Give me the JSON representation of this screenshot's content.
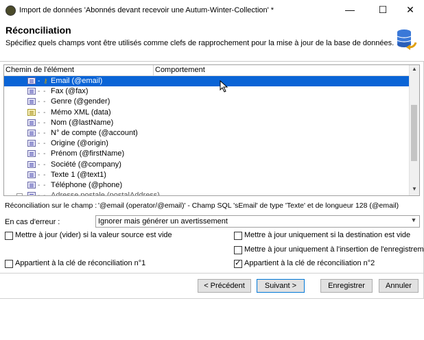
{
  "window": {
    "title": "Import de données 'Abonnés devant recevoir une Autum-Winter-Collection' *",
    "minimize": "—",
    "maximize": "☐",
    "close": "✕"
  },
  "header": {
    "title": "Réconciliation",
    "subtitle": "Spécifiez quels champs vont être utilisés comme clefs de rapprochement pour la mise à jour de la base de données."
  },
  "grid": {
    "columns": [
      "Chemin de l'élément",
      "Comportement"
    ],
    "rows": [
      {
        "label": "Email (@email)",
        "icon": "field-icon",
        "selected": true,
        "key": true
      },
      {
        "label": "Fax (@fax)",
        "icon": "field-icon"
      },
      {
        "label": "Genre (@gender)",
        "icon": "field-icon"
      },
      {
        "label": "Mémo XML (data)",
        "icon": "memo-icon"
      },
      {
        "label": "Nom (@lastName)",
        "icon": "field-icon"
      },
      {
        "label": "N° de compte (@account)",
        "icon": "field-icon"
      },
      {
        "label": "Origine (@origin)",
        "icon": "field-icon"
      },
      {
        "label": "Prénom (@firstName)",
        "icon": "field-icon"
      },
      {
        "label": "Société (@company)",
        "icon": "field-icon"
      },
      {
        "label": "Texte 1 (@text1)",
        "icon": "field-icon"
      },
      {
        "label": "Téléphone (@phone)",
        "icon": "field-icon"
      },
      {
        "label": "Adresse postale (postalAddress)",
        "icon": "folder-icon",
        "partial": true
      }
    ]
  },
  "reconciliation": {
    "label": "Réconciliation sur le champ :",
    "value": "'@email (operator/@email)' - Champ SQL 'sEmail' de type 'Texte' et de longueur 128 (@email)"
  },
  "error": {
    "label": "En cas d'erreur :",
    "selected": "Ignorer mais générer un avertissement"
  },
  "options": {
    "empty_update": {
      "label": "Mettre à jour (vider) si la valeur source est vide",
      "checked": false
    },
    "update_if_empty": {
      "label": "Mettre à jour uniquement si la destination est vide",
      "checked": false
    },
    "update_on_insert": {
      "label": "Mettre à jour uniquement à l'insertion de l'enregistrement",
      "checked": false
    },
    "key1": {
      "label": "Appartient à la clé de réconciliation n°1",
      "checked": false
    },
    "key2": {
      "label": "Appartient à la clé de réconciliation n°2",
      "checked": true
    }
  },
  "buttons": {
    "previous": "< Précédent",
    "next": "Suivant >",
    "save": "Enregistrer",
    "cancel": "Annuler"
  },
  "colors": {
    "selection": "#0a64d6",
    "default_button_border": "#0078d7"
  }
}
